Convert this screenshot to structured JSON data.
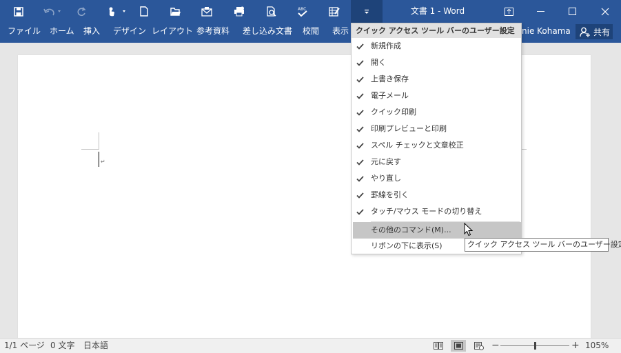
{
  "window": {
    "title": "文書 1 - Word"
  },
  "qat": {
    "icons": [
      "save-icon",
      "undo-icon",
      "redo-icon",
      "touch-mode-icon",
      "new-document-icon",
      "open-icon",
      "email-icon",
      "quick-print-icon",
      "print-preview-icon",
      "spell-check-icon",
      "draw-table-icon",
      "customize-qat-icon"
    ]
  },
  "ribbon": {
    "tabs": [
      "ファイル",
      "ホーム",
      "挿入",
      "デザイン",
      "レイアウト",
      "参考資料",
      "差し込み文書",
      "校閲",
      "表示"
    ],
    "user_name": "nie Kohama",
    "share_label": "共有"
  },
  "menu": {
    "header": "クイック アクセス ツール バーのユーザー設定",
    "checked_items": [
      "新規作成",
      "開く",
      "上書き保存",
      "電子メール",
      "クイック印刷",
      "印刷プレビューと印刷",
      "スペル チェックと文章校正",
      "元に戻す",
      "やり直し",
      "罫線を引く",
      "タッチ/マウス モードの切り替え"
    ],
    "more_commands": "その他のコマンド(M)...",
    "show_below": "リボンの下に表示(S)"
  },
  "tooltip": {
    "text": "クイック アクセス ツール バーのユーザー設定"
  },
  "status": {
    "page": "1/1 ページ",
    "words": "0 文字",
    "language": "日本語",
    "zoom": "105%",
    "zoom_minus": "−",
    "zoom_plus": "+",
    "zoom_level_fraction": 0.5
  },
  "colors": {
    "title_bar": "#2b579a",
    "highlight": "#c6c6c6"
  }
}
